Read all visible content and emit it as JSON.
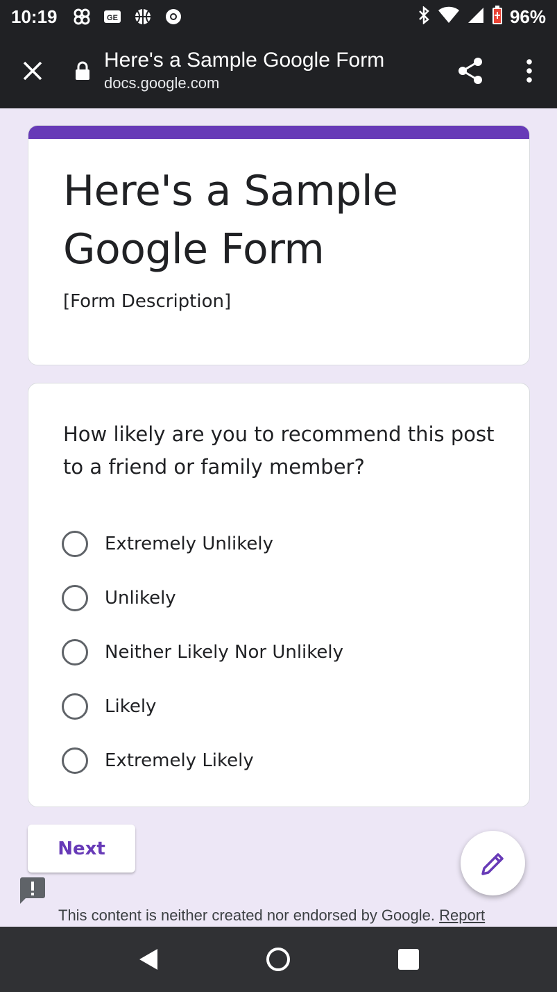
{
  "status_bar": {
    "time": "10:19",
    "battery": "96%"
  },
  "toolbar": {
    "title": "Here's a Sample Google Form",
    "url": "docs.google.com"
  },
  "form": {
    "title": "Here's a Sample Google Form",
    "description": "[Form Description]",
    "accent_color": "#673ab7"
  },
  "question": {
    "text": "How likely are you to recommend this post to a friend or family member?",
    "options": [
      "Extremely Unlikely",
      "Unlikely",
      "Neither Likely Nor Unlikely",
      "Likely",
      "Extremely Likely"
    ]
  },
  "buttons": {
    "next_label": "Next"
  },
  "footer": {
    "text": "This content is neither created nor endorsed by Google.",
    "link_label": "Report"
  },
  "icons": {
    "close": "close-icon",
    "lock": "lock-icon",
    "share": "share-icon",
    "menu": "more-vert-icon",
    "edit": "pencil-icon",
    "report": "feedback-icon",
    "back": "back-triangle-icon",
    "home": "home-circle-icon",
    "recents": "recents-square-icon"
  }
}
